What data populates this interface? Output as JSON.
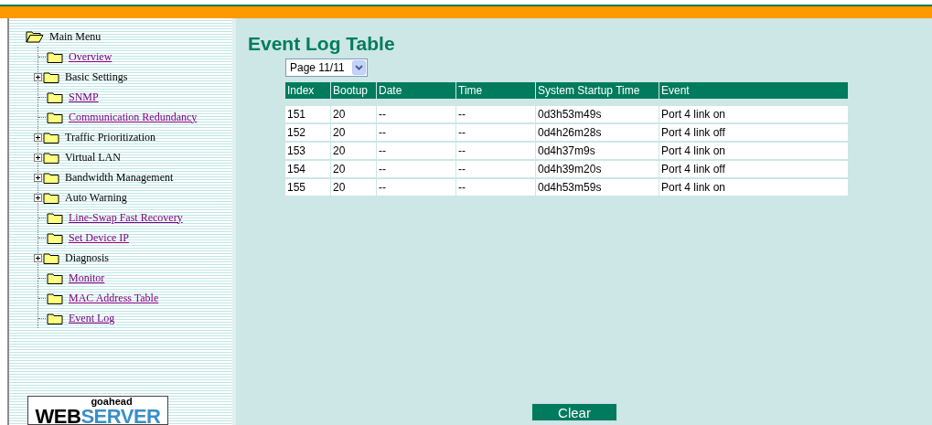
{
  "sidebar": {
    "root": {
      "label": "Main Menu",
      "expanded": true,
      "children": [
        {
          "label": "Overview",
          "kind": "link"
        },
        {
          "label": "Basic Settings",
          "kind": "group"
        },
        {
          "label": "SNMP",
          "kind": "link"
        },
        {
          "label": "Communication Redundancy",
          "kind": "link"
        },
        {
          "label": "Traffic Prioritization",
          "kind": "group"
        },
        {
          "label": "Virtual LAN",
          "kind": "group"
        },
        {
          "label": "Bandwidth Management",
          "kind": "group"
        },
        {
          "label": "Auto Warning",
          "kind": "group"
        },
        {
          "label": "Line-Swap Fast Recovery",
          "kind": "link"
        },
        {
          "label": "Set Device IP",
          "kind": "link"
        },
        {
          "label": "Diagnosis",
          "kind": "group"
        },
        {
          "label": "Monitor",
          "kind": "link"
        },
        {
          "label": "MAC Address Table",
          "kind": "link"
        },
        {
          "label": "Event Log",
          "kind": "link"
        }
      ]
    },
    "logo": {
      "top": "goahead",
      "left": "WEB",
      "right": "SERVER"
    }
  },
  "main": {
    "title": "Event Log Table",
    "page_select": "Page 11/11",
    "table": {
      "columns": [
        "Index",
        "Bootup",
        "Date",
        "Time",
        "System Startup Time",
        "Event"
      ],
      "rows": [
        [
          "151",
          "20",
          "--",
          "--",
          "0d3h53m49s",
          "Port 4 link on"
        ],
        [
          "152",
          "20",
          "--",
          "--",
          "0d4h26m28s",
          "Port 4 link off"
        ],
        [
          "153",
          "20",
          "--",
          "--",
          "0d4h37m9s",
          "Port 4 link on"
        ],
        [
          "154",
          "20",
          "--",
          "--",
          "0d4h39m20s",
          "Port 4 link off"
        ],
        [
          "155",
          "20",
          "--",
          "--",
          "0d4h53m59s",
          "Port 4 link on"
        ]
      ]
    },
    "button": "Clear"
  }
}
